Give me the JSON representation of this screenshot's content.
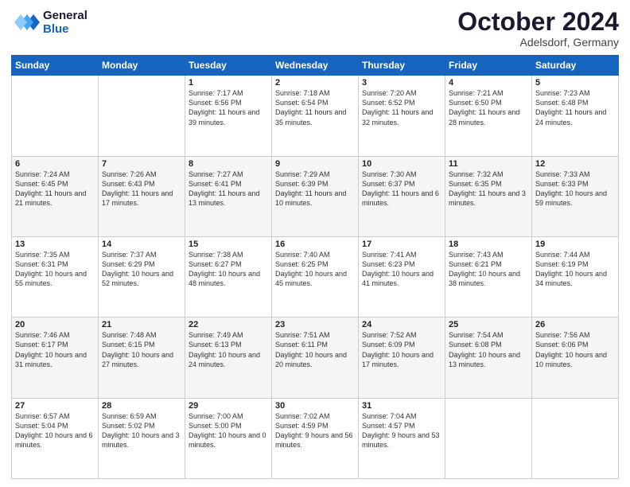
{
  "header": {
    "logo_line1": "General",
    "logo_line2": "Blue",
    "month": "October 2024",
    "location": "Adelsdorf, Germany"
  },
  "weekdays": [
    "Sunday",
    "Monday",
    "Tuesday",
    "Wednesday",
    "Thursday",
    "Friday",
    "Saturday"
  ],
  "weeks": [
    [
      {
        "day": "",
        "info": ""
      },
      {
        "day": "",
        "info": ""
      },
      {
        "day": "1",
        "info": "Sunrise: 7:17 AM\nSunset: 6:56 PM\nDaylight: 11 hours and 39 minutes."
      },
      {
        "day": "2",
        "info": "Sunrise: 7:18 AM\nSunset: 6:54 PM\nDaylight: 11 hours and 35 minutes."
      },
      {
        "day": "3",
        "info": "Sunrise: 7:20 AM\nSunset: 6:52 PM\nDaylight: 11 hours and 32 minutes."
      },
      {
        "day": "4",
        "info": "Sunrise: 7:21 AM\nSunset: 6:50 PM\nDaylight: 11 hours and 28 minutes."
      },
      {
        "day": "5",
        "info": "Sunrise: 7:23 AM\nSunset: 6:48 PM\nDaylight: 11 hours and 24 minutes."
      }
    ],
    [
      {
        "day": "6",
        "info": "Sunrise: 7:24 AM\nSunset: 6:45 PM\nDaylight: 11 hours and 21 minutes."
      },
      {
        "day": "7",
        "info": "Sunrise: 7:26 AM\nSunset: 6:43 PM\nDaylight: 11 hours and 17 minutes."
      },
      {
        "day": "8",
        "info": "Sunrise: 7:27 AM\nSunset: 6:41 PM\nDaylight: 11 hours and 13 minutes."
      },
      {
        "day": "9",
        "info": "Sunrise: 7:29 AM\nSunset: 6:39 PM\nDaylight: 11 hours and 10 minutes."
      },
      {
        "day": "10",
        "info": "Sunrise: 7:30 AM\nSunset: 6:37 PM\nDaylight: 11 hours and 6 minutes."
      },
      {
        "day": "11",
        "info": "Sunrise: 7:32 AM\nSunset: 6:35 PM\nDaylight: 11 hours and 3 minutes."
      },
      {
        "day": "12",
        "info": "Sunrise: 7:33 AM\nSunset: 6:33 PM\nDaylight: 10 hours and 59 minutes."
      }
    ],
    [
      {
        "day": "13",
        "info": "Sunrise: 7:35 AM\nSunset: 6:31 PM\nDaylight: 10 hours and 55 minutes."
      },
      {
        "day": "14",
        "info": "Sunrise: 7:37 AM\nSunset: 6:29 PM\nDaylight: 10 hours and 52 minutes."
      },
      {
        "day": "15",
        "info": "Sunrise: 7:38 AM\nSunset: 6:27 PM\nDaylight: 10 hours and 48 minutes."
      },
      {
        "day": "16",
        "info": "Sunrise: 7:40 AM\nSunset: 6:25 PM\nDaylight: 10 hours and 45 minutes."
      },
      {
        "day": "17",
        "info": "Sunrise: 7:41 AM\nSunset: 6:23 PM\nDaylight: 10 hours and 41 minutes."
      },
      {
        "day": "18",
        "info": "Sunrise: 7:43 AM\nSunset: 6:21 PM\nDaylight: 10 hours and 38 minutes."
      },
      {
        "day": "19",
        "info": "Sunrise: 7:44 AM\nSunset: 6:19 PM\nDaylight: 10 hours and 34 minutes."
      }
    ],
    [
      {
        "day": "20",
        "info": "Sunrise: 7:46 AM\nSunset: 6:17 PM\nDaylight: 10 hours and 31 minutes."
      },
      {
        "day": "21",
        "info": "Sunrise: 7:48 AM\nSunset: 6:15 PM\nDaylight: 10 hours and 27 minutes."
      },
      {
        "day": "22",
        "info": "Sunrise: 7:49 AM\nSunset: 6:13 PM\nDaylight: 10 hours and 24 minutes."
      },
      {
        "day": "23",
        "info": "Sunrise: 7:51 AM\nSunset: 6:11 PM\nDaylight: 10 hours and 20 minutes."
      },
      {
        "day": "24",
        "info": "Sunrise: 7:52 AM\nSunset: 6:09 PM\nDaylight: 10 hours and 17 minutes."
      },
      {
        "day": "25",
        "info": "Sunrise: 7:54 AM\nSunset: 6:08 PM\nDaylight: 10 hours and 13 minutes."
      },
      {
        "day": "26",
        "info": "Sunrise: 7:56 AM\nSunset: 6:06 PM\nDaylight: 10 hours and 10 minutes."
      }
    ],
    [
      {
        "day": "27",
        "info": "Sunrise: 6:57 AM\nSunset: 5:04 PM\nDaylight: 10 hours and 6 minutes."
      },
      {
        "day": "28",
        "info": "Sunrise: 6:59 AM\nSunset: 5:02 PM\nDaylight: 10 hours and 3 minutes."
      },
      {
        "day": "29",
        "info": "Sunrise: 7:00 AM\nSunset: 5:00 PM\nDaylight: 10 hours and 0 minutes."
      },
      {
        "day": "30",
        "info": "Sunrise: 7:02 AM\nSunset: 4:59 PM\nDaylight: 9 hours and 56 minutes."
      },
      {
        "day": "31",
        "info": "Sunrise: 7:04 AM\nSunset: 4:57 PM\nDaylight: 9 hours and 53 minutes."
      },
      {
        "day": "",
        "info": ""
      },
      {
        "day": "",
        "info": ""
      }
    ]
  ]
}
